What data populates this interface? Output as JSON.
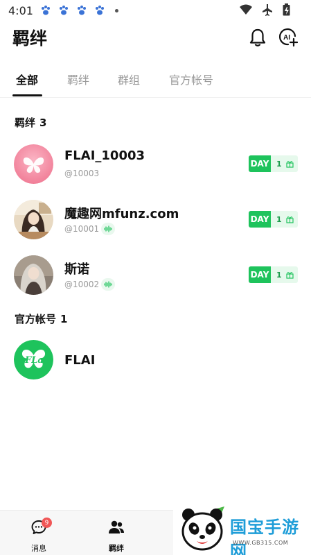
{
  "status_bar": {
    "time": "4:01"
  },
  "header": {
    "title": "羁绊"
  },
  "tabs": [
    {
      "label": "全部",
      "active": true
    },
    {
      "label": "羁绊",
      "active": false
    },
    {
      "label": "群组",
      "active": false
    },
    {
      "label": "官方帐号",
      "active": false
    }
  ],
  "bonds_section": {
    "title": "羁绊",
    "count": "3"
  },
  "contacts": [
    {
      "name": "FLAI_10003",
      "id": "@10003",
      "day_label": "DAY",
      "day_count": "1",
      "has_voice": false
    },
    {
      "name": "魔趣网mfunz.com",
      "id": "@10001",
      "day_label": "DAY",
      "day_count": "1",
      "has_voice": true
    },
    {
      "name": "斯诺",
      "id": "@10002",
      "day_label": "DAY",
      "day_count": "1",
      "has_voice": true
    }
  ],
  "official_section": {
    "title": "官方帐号",
    "count": "1"
  },
  "official_accounts": [
    {
      "name": "FLAI",
      "logo_text": "FLai"
    }
  ],
  "bottom_nav": [
    {
      "label": "消息",
      "badge": "9",
      "active": false
    },
    {
      "label": "羁绊",
      "badge": "",
      "active": true
    }
  ],
  "watermark": {
    "text": "国宝手游网",
    "url": "WWW.GB315.COM"
  },
  "colors": {
    "accent_green": "#1ec35c",
    "badge_red": "#f05656",
    "watermark_blue": "#1e9dd8"
  }
}
